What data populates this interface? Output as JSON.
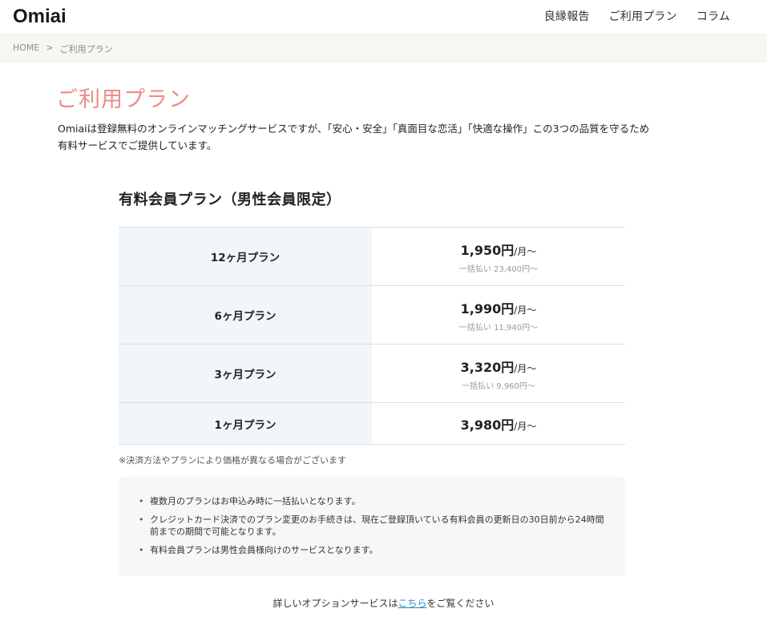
{
  "header": {
    "logo_text": "Omiai",
    "nav": [
      "良縁報告",
      "ご利用プラン",
      "コラム"
    ]
  },
  "breadcrumb": {
    "home": "HOME",
    "separator": ">",
    "current": "ご利用プラン"
  },
  "page": {
    "title": "ご利用プラン",
    "intro_line1": "Omiaiは登録無料のオンラインマッチングサービスですが、「安心・安全」「真面目な恋活」「快適な操作」この3つの品質を守るため",
    "intro_line2": "有料サービスでご提供しています。"
  },
  "plans": {
    "title": "有料会員プラン（男性会員限定）",
    "rows": [
      {
        "name": "12ヶ月プラン",
        "price": "1,950円",
        "unit": "/月〜",
        "lump": "一括払い 23,400円〜"
      },
      {
        "name": "6ヶ月プラン",
        "price": "1,990円",
        "unit": "/月〜",
        "lump": "一括払い 11,940円〜"
      },
      {
        "name": "3ヶ月プラン",
        "price": "3,320円",
        "unit": "/月〜",
        "lump": "一括払い 9,960円〜"
      },
      {
        "name": "1ヶ月プラン",
        "price": "3,980円",
        "unit": "/月〜",
        "lump": ""
      }
    ],
    "note": "※決済方法やプランにより価格が異なる場合がございます"
  },
  "info": {
    "bullet": "•",
    "items": [
      "複数月のプランはお申込み時に一括払いとなります。",
      "クレジットカード決済でのプラン変更のお手続きは、現在ご登録頂いている有料会員の更新日の30日前から24時間前までの期間で可能となります。",
      "有料会員プランは男性会員様向けのサービスとなります。"
    ]
  },
  "footer": {
    "prefix": "詳しいオプションサービスは",
    "link": "こちら",
    "suffix": "をご覧ください"
  },
  "colors": {
    "title_pink": "#ec8d86",
    "plan_cell_bg": "#f0f6fa",
    "link_blue": "#2a8fc4"
  }
}
